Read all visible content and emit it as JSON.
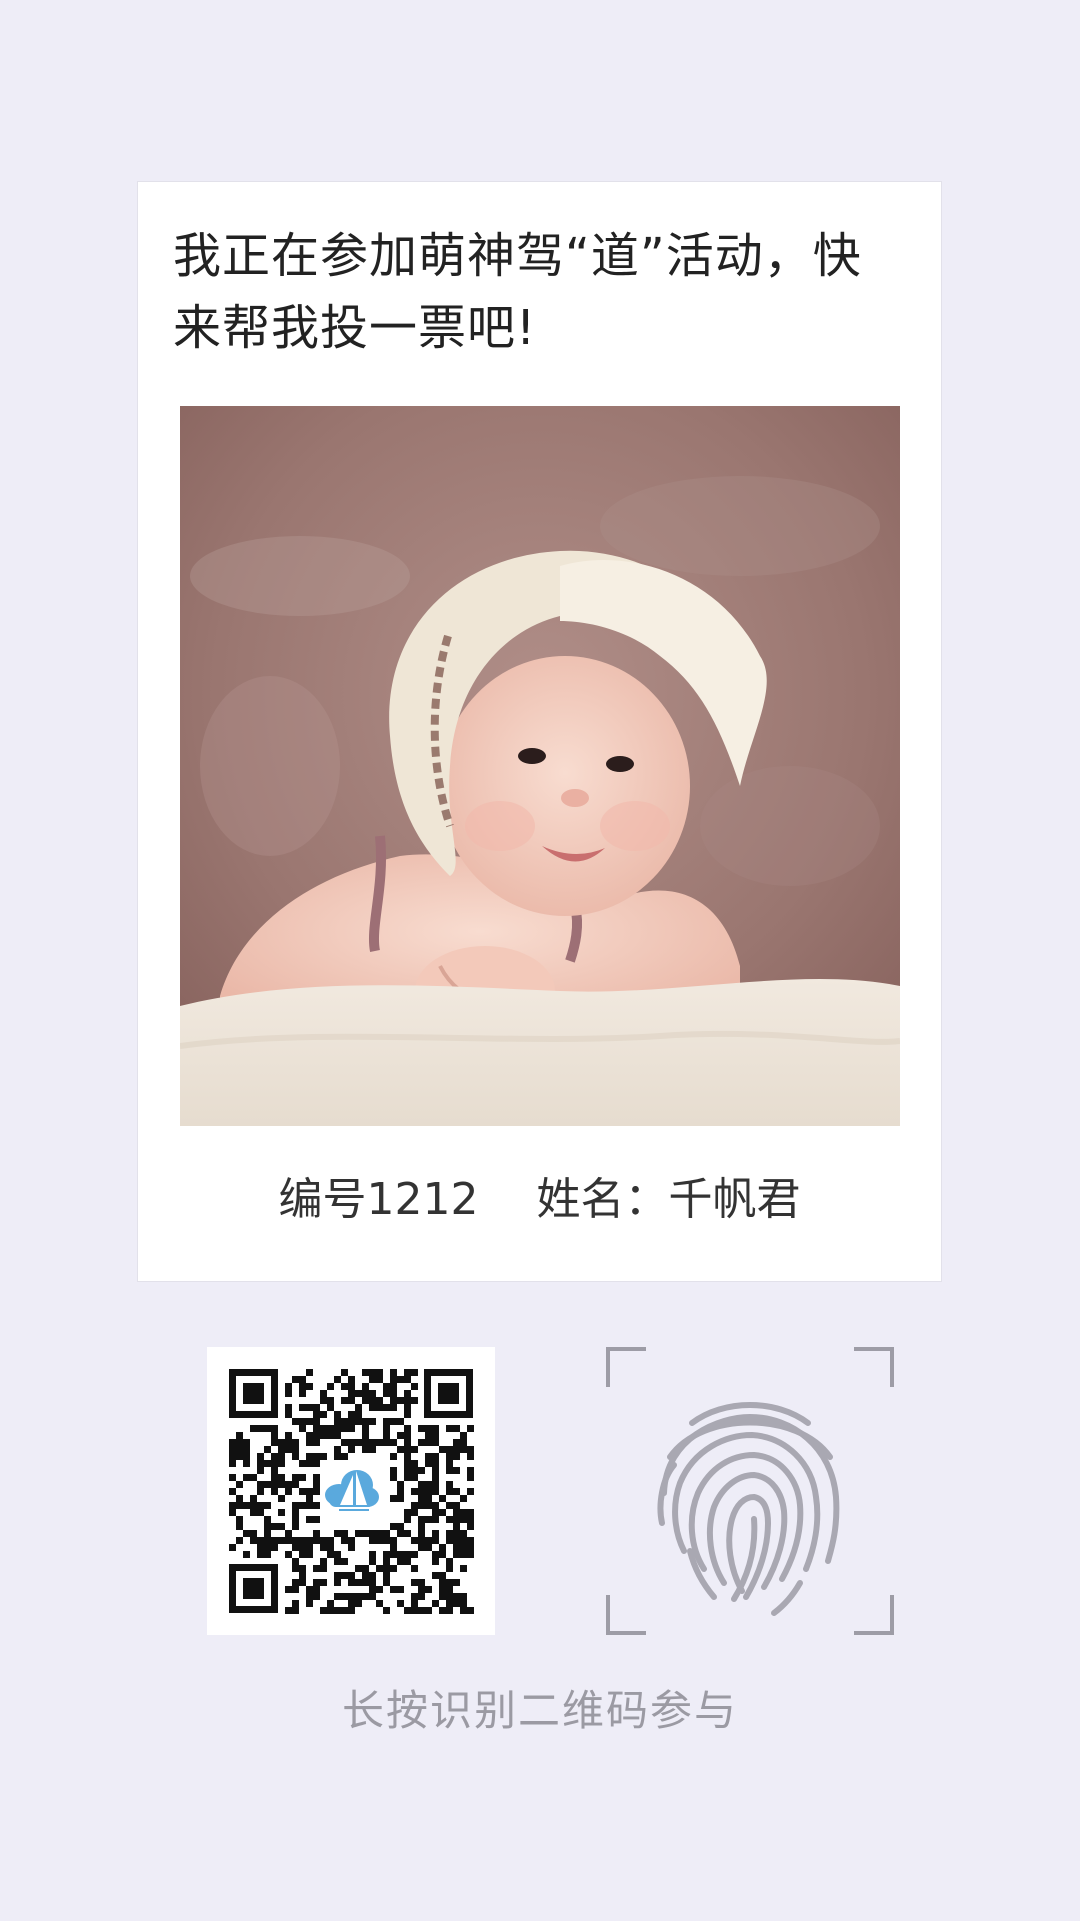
{
  "card": {
    "headline_line1": "我正在参加萌神驾“道”活动，快",
    "headline_line2": "来帮我投一票吧!",
    "photo_icon": "baby-photo",
    "number_label": "编号1212",
    "name_label": "姓名：千帆君"
  },
  "qr_code": {
    "icon": "qr-code-icon",
    "center_logo": "cloud-sailboat-logo"
  },
  "fingerprint": {
    "icon": "fingerprint-icon"
  },
  "hint": "长按识别二维码参与",
  "colors": {
    "background": "#eeedf7",
    "card": "#ffffff",
    "hint_text": "#9b9aa3",
    "fingerprint": "#a9a8b2",
    "scan_frame": "#9d9ca6",
    "logo_blue": "#5aa9dd"
  }
}
